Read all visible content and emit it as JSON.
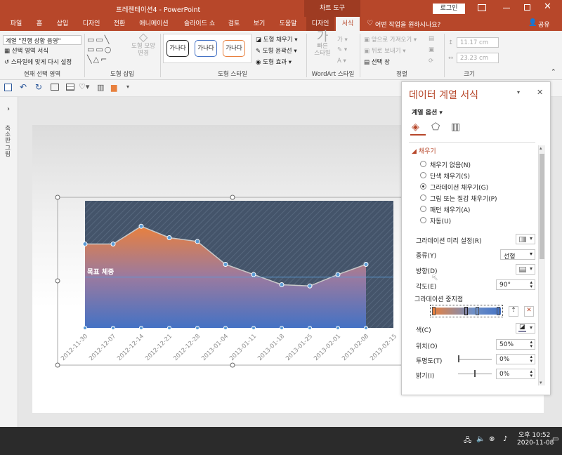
{
  "titlebar": {
    "doc_title": "프레젠테이션4  -  PowerPoint",
    "context_tab": "차트 도구",
    "login": "로그인",
    "ribbon_display_icon": "ribbon-display-icon",
    "minimize_icon": "minimize-icon",
    "maximize_icon": "maximize-icon",
    "close_icon": "close-icon"
  },
  "tabs": [
    "파일",
    "홈",
    "삽입",
    "디자인",
    "전환",
    "애니메이션",
    "슬라이드 쇼",
    "검토",
    "보기",
    "도움말",
    "디자인",
    "서식"
  ],
  "tell_me": "어떤 작업을 원하시나요?",
  "share": "공유",
  "ribbon": {
    "current_selection": {
      "dropdown": "계열 \"진행 상황 음영\"",
      "format_selection": "선택 영역 서식",
      "reset_style": "스타일에 맞게 다시 설정",
      "label": "현재 선택 영역"
    },
    "insert_shapes": {
      "change_shape": "도형 모양\n변경",
      "label": "도형 삽입"
    },
    "shape_styles": {
      "samples": [
        "가나다",
        "가나다",
        "가나다"
      ],
      "fill": "도형 채우기",
      "outline": "도형 윤곽선",
      "effects": "도형 효과",
      "label": "도형 스타일"
    },
    "wordart": {
      "quick": "빠른\n스타일",
      "label": "WordArt 스타일"
    },
    "arrange": {
      "forward": "앞으로 가져오기",
      "backward": "뒤로 보내기",
      "pane": "선택 창",
      "label": "정렬"
    },
    "size": {
      "height": "11.17 cm",
      "width": "23.23 cm",
      "label": "크기"
    }
  },
  "qat_icons": [
    "save-icon",
    "undo-icon",
    "redo-icon",
    "present-icon",
    "table-icon",
    "shapes-icon",
    "chart-icon"
  ],
  "leftbar": {
    "thumbnails_label": "축소판 그림"
  },
  "chart": {
    "target_label": "목표 체중",
    "target_y": 40,
    "chart_data": {
      "type": "area",
      "x": [
        "2012-11-30",
        "2012-12-07",
        "2012-12-14",
        "2012-12-21",
        "2012-12-28",
        "2013-01-04",
        "2013-01-11",
        "2013-01-18",
        "2013-01-25",
        "2013-02-01",
        "2013-02-08",
        "2013-02-15"
      ],
      "ylim": [
        0,
        100
      ],
      "series": [
        {
          "values": [
            66,
            66,
            80,
            71,
            68,
            50,
            42,
            34,
            33,
            42,
            50,
            null
          ]
        }
      ]
    }
  },
  "pane": {
    "title": "데이터 계열 서식",
    "series_options": "계열 옵션",
    "section": "채우기",
    "options": [
      "채우기 없음(N)",
      "단색 채우기(S)",
      "그라데이션 채우기(G)",
      "그림 또는 질감 채우기(P)",
      "패턴 채우기(A)",
      "자동(U)"
    ],
    "selected_option": 2,
    "preset_label": "그라데이션 미리 설정(R)",
    "type_label": "종류(Y)",
    "type_value": "선형",
    "direction_label": "방향(D)",
    "angle_label": "각도(E)",
    "angle_value": "90°",
    "stops_label": "그라데이션 중지점",
    "color_label": "색(C)",
    "position_label": "위치(O)",
    "position_value": "50%",
    "transparency_label": "투명도(T)",
    "transparency_value": "0%",
    "brightness_label": "밝기(I)",
    "brightness_value": "0%"
  },
  "taskbar": {
    "time": "오후 10:52",
    "date": "2020-11-08"
  },
  "colors": {
    "accent": "#b7472a",
    "area_top": "#e8803e",
    "area_bottom": "#4472c4",
    "plot_bg": "#44546a",
    "pane_title": "#b7472a"
  }
}
